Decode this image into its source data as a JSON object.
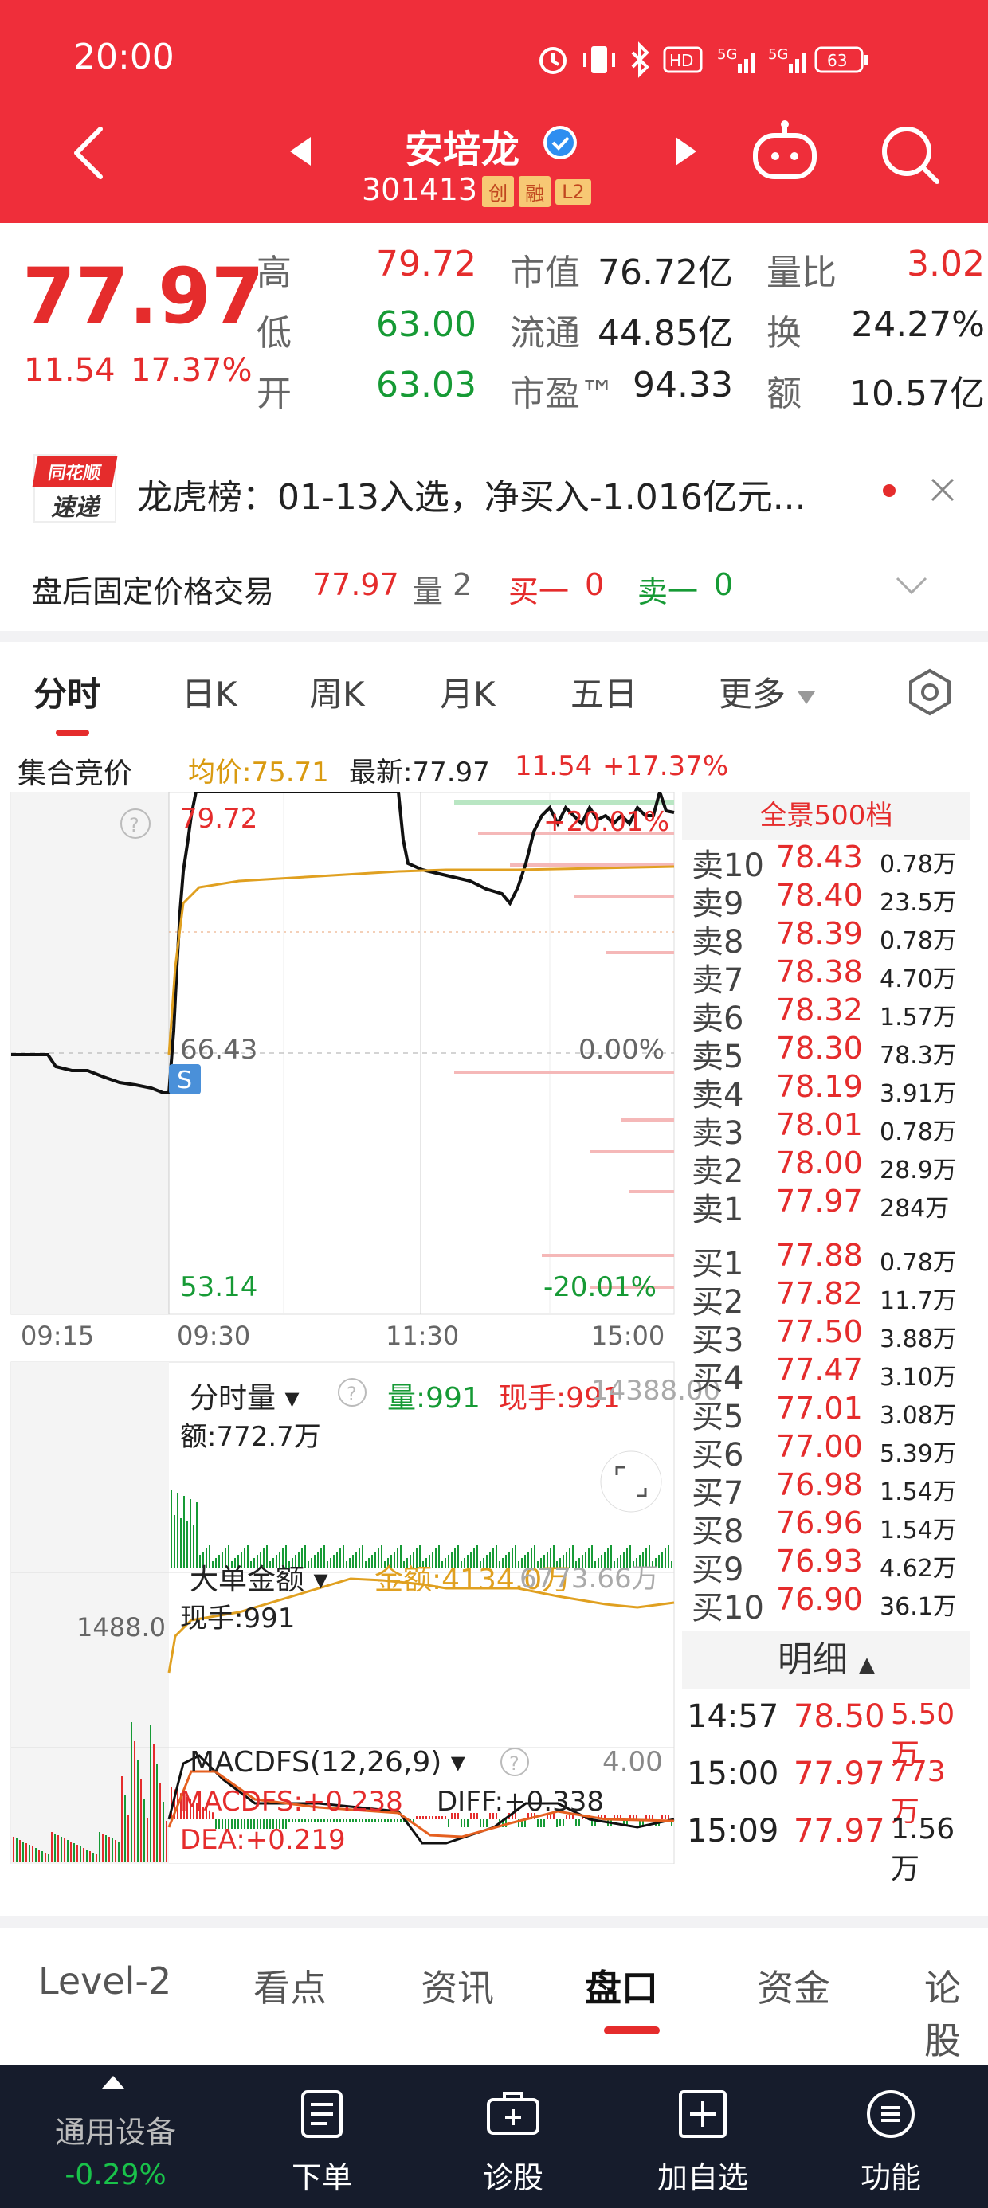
{
  "status": {
    "time": "20:00",
    "battery": "63",
    "net1": "5G",
    "net2": "5G",
    "hd": "HD"
  },
  "header": {
    "name": "安培龙",
    "code": "301413",
    "badges": [
      "创",
      "融",
      "L2"
    ]
  },
  "quote": {
    "price": "77.97",
    "change": "11.54",
    "pct": "17.37%",
    "rows": [
      {
        "l1": "高",
        "v1": "79.72",
        "l2": "市值",
        "v2": "76.72亿",
        "l3": "量比",
        "v3": "3.02"
      },
      {
        "l1": "低",
        "v1": "63.00",
        "l2": "流通",
        "v2": "44.85亿",
        "l3": "换",
        "v3": "24.27%"
      },
      {
        "l1": "开",
        "v1": "63.03",
        "l2": "市盈™",
        "v2": "94.33",
        "l3": "额",
        "v3": "10.57亿"
      }
    ]
  },
  "news": {
    "logo_top": "同花顺",
    "logo_bottom": "速递",
    "text": "龙虎榜：01-13入选，净买入-1.016亿元..."
  },
  "afterhours": {
    "label": "盘后固定价格交易",
    "price": "77.97",
    "vol_label": "量",
    "vol": "2",
    "buy_label": "买一",
    "buy": "0",
    "sell_label": "卖一",
    "sell": "0"
  },
  "tabs": [
    "分时",
    "日K",
    "周K",
    "月K",
    "五日",
    "更多"
  ],
  "chart_header": {
    "auction": "集合竞价",
    "avg": "均价:75.71",
    "latest": "最新:77.97",
    "chg": "11.54",
    "pct": "+17.37%"
  },
  "price_axis": {
    "high": "79.72",
    "mid": "66.43",
    "low": "53.14",
    "pct_high": "+20.01%",
    "pct_mid": "0.00%",
    "pct_low": "-20.01%"
  },
  "time_axis": [
    "09:15",
    "09:30",
    "11:30",
    "15:00"
  ],
  "volume_panel": {
    "title": "分时量",
    "vol": "量:991",
    "hand": "现手:991",
    "max": "14388.00",
    "amount": "额:772.7万"
  },
  "bigorder_panel": {
    "title": "大单金额",
    "amount": "金额:4134.0万",
    "max": "6773.66万",
    "hand": "现手:991",
    "left_val": "1488.0"
  },
  "macd_panel": {
    "title": "MACDFS(12,26,9)",
    "macd": "MACDFS:+0.238",
    "diff": "DIFF:+0.338",
    "dea": "DEA:+0.219",
    "max": "4.00"
  },
  "order_book": {
    "title": "全景500档",
    "asks": [
      {
        "label": "卖10",
        "price": "78.43",
        "vol": "0.78万"
      },
      {
        "label": "卖9",
        "price": "78.40",
        "vol": "23.5万"
      },
      {
        "label": "卖8",
        "price": "78.39",
        "vol": "0.78万"
      },
      {
        "label": "卖7",
        "price": "78.38",
        "vol": "4.70万"
      },
      {
        "label": "卖6",
        "price": "78.32",
        "vol": "1.57万"
      },
      {
        "label": "卖5",
        "price": "78.30",
        "vol": "78.3万"
      },
      {
        "label": "卖4",
        "price": "78.19",
        "vol": "3.91万"
      },
      {
        "label": "卖3",
        "price": "78.01",
        "vol": "0.78万"
      },
      {
        "label": "卖2",
        "price": "78.00",
        "vol": "28.9万"
      },
      {
        "label": "卖1",
        "price": "77.97",
        "vol": "284万"
      }
    ],
    "bids": [
      {
        "label": "买1",
        "price": "77.88",
        "vol": "0.78万"
      },
      {
        "label": "买2",
        "price": "77.82",
        "vol": "11.7万"
      },
      {
        "label": "买3",
        "price": "77.50",
        "vol": "3.88万"
      },
      {
        "label": "买4",
        "price": "77.47",
        "vol": "3.10万"
      },
      {
        "label": "买5",
        "price": "77.01",
        "vol": "3.08万"
      },
      {
        "label": "买6",
        "price": "77.00",
        "vol": "5.39万"
      },
      {
        "label": "买7",
        "price": "76.98",
        "vol": "1.54万"
      },
      {
        "label": "买8",
        "price": "76.96",
        "vol": "1.54万"
      },
      {
        "label": "买9",
        "price": "76.93",
        "vol": "4.62万"
      },
      {
        "label": "买10",
        "price": "76.90",
        "vol": "36.1万"
      }
    ],
    "detail_label": "明细",
    "trades": [
      {
        "time": "14:57",
        "price": "78.50",
        "vol": "5.50万"
      },
      {
        "time": "15:00",
        "price": "77.97",
        "vol": "773万"
      },
      {
        "time": "15:09",
        "price": "77.97",
        "vol": "1.56万"
      }
    ]
  },
  "bottom_tabs": [
    "Level-2",
    "看点",
    "资讯",
    "盘口",
    "资金",
    "论股"
  ],
  "nav": {
    "device": "通用设备",
    "device_pct": "-0.29%",
    "items": [
      "下单",
      "诊股",
      "加自选",
      "功能"
    ]
  },
  "colors": {
    "brand": "#ef2e3a",
    "up": "#e52c2c",
    "down": "#169a35",
    "nav_bg": "#161c2c",
    "avg_line": "#e0a020"
  },
  "icons": [
    "alarm-icon",
    "vibrate-icon",
    "bluetooth-icon",
    "hd-icon",
    "signal-icon",
    "battery-icon",
    "back-icon",
    "prev-icon",
    "next-icon",
    "robot-icon",
    "search-icon",
    "verified-icon",
    "close-icon",
    "chevron-down-icon",
    "settings-icon",
    "help-icon",
    "expand-icon",
    "up-arrow-icon",
    "order-icon",
    "diagnose-icon",
    "add-icon",
    "menu-icon"
  ]
}
